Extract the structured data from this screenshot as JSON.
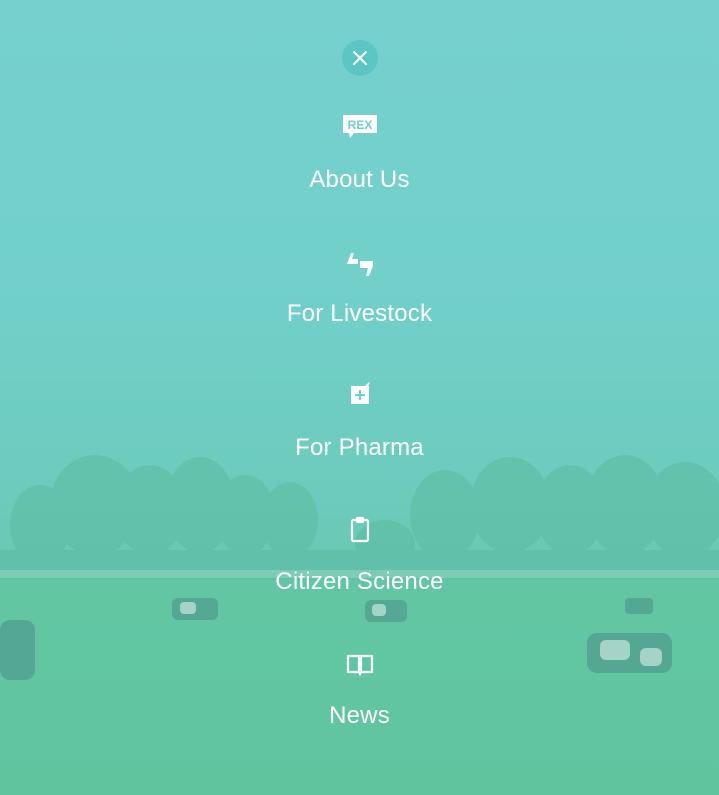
{
  "close": {
    "icon": "close-icon"
  },
  "menu": {
    "items": [
      {
        "label": "About Us",
        "icon": "rex-logo-icon",
        "icon_text": "REX"
      },
      {
        "label": "For Livestock",
        "icon": "quote-icon"
      },
      {
        "label": "For Pharma",
        "icon": "medicine-icon"
      },
      {
        "label": "Citizen Science",
        "icon": "clipboard-icon"
      },
      {
        "label": "News",
        "icon": "book-icon"
      }
    ]
  },
  "colors": {
    "overlay": "#70cfca",
    "text": "#ffffff"
  }
}
